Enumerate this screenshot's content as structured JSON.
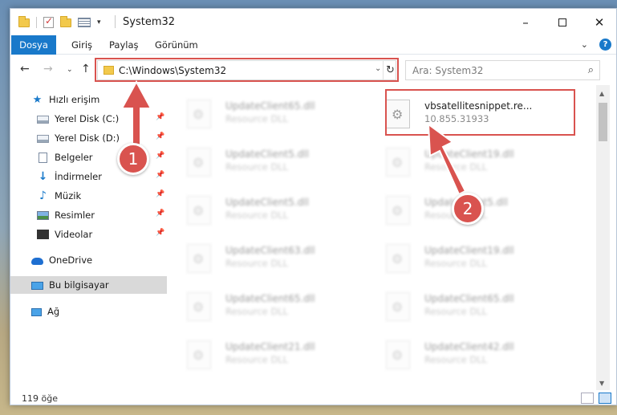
{
  "window": {
    "title": "System32",
    "controls": {
      "minimize": "–",
      "maximize": "",
      "close": "✕"
    }
  },
  "ribbon": {
    "tabs": [
      {
        "label": "Dosya",
        "active": true
      },
      {
        "label": "Giriş"
      },
      {
        "label": "Paylaş"
      },
      {
        "label": "Görünüm"
      }
    ],
    "collapse": "⌄",
    "help": "?"
  },
  "nav": {
    "back": "←",
    "forward": "→",
    "recent": "⌄",
    "up": "↑",
    "address": "C:\\Windows\\System32",
    "address_dropdown": "⌄",
    "refresh": "↻",
    "search_placeholder": "Ara: System32",
    "search_icon": "⌕"
  },
  "sidebar": {
    "items": [
      {
        "label": "Hızlı erişim",
        "icon": "star-icon"
      },
      {
        "label": "Yerel Disk (C:)",
        "icon": "drive-icon",
        "pinned": true
      },
      {
        "label": "Yerel Disk (D:)",
        "icon": "drive-icon",
        "pinned": true
      },
      {
        "label": "Belgeler",
        "icon": "documents-icon",
        "pinned": true
      },
      {
        "label": "İndirmeler",
        "icon": "downloads-icon",
        "pinned": true
      },
      {
        "label": "Müzik",
        "icon": "music-icon",
        "pinned": true
      },
      {
        "label": "Resimler",
        "icon": "pictures-icon",
        "pinned": true
      },
      {
        "label": "Videolar",
        "icon": "videos-icon",
        "pinned": true
      },
      {
        "label": "OneDrive",
        "icon": "onedrive-icon"
      },
      {
        "label": "Bu bilgisayar",
        "icon": "this-pc-icon",
        "selected": true
      },
      {
        "label": "Ağ",
        "icon": "network-icon"
      }
    ],
    "pin_glyph": "📌"
  },
  "files": {
    "left_column": [
      {
        "name": "UpdateClient65.dll",
        "desc": "Resource DLL"
      },
      {
        "name": "UpdateClient5.dll",
        "desc": "Resource DLL"
      },
      {
        "name": "UpdateClient5.dll",
        "desc": "Resource DLL"
      },
      {
        "name": "UpdateClient63.dll",
        "desc": "Resource DLL"
      },
      {
        "name": "UpdateClient65.dll",
        "desc": "Resource DLL"
      },
      {
        "name": "UpdateClient21.dll",
        "desc": "Resource DLL"
      }
    ],
    "right_column": [
      {
        "name": "vbsatellitesnippet.re...",
        "desc": "10.855.31933",
        "highlighted": true
      },
      {
        "name": "UpdateClient19.dll",
        "desc": "Resource DLL"
      },
      {
        "name": "UpdateClient5.dll",
        "desc": "Resource DLL"
      },
      {
        "name": "UpdateClient19.dll",
        "desc": "Resource DLL"
      },
      {
        "name": "UpdateClient65.dll",
        "desc": "Resource DLL"
      },
      {
        "name": "UpdateClient42.dll",
        "desc": "Resource DLL"
      }
    ]
  },
  "status": {
    "item_count": "119 öğe"
  },
  "annotations": {
    "marker_1": "1",
    "marker_2": "2",
    "color": "#d9534f"
  },
  "colors": {
    "accent": "#1979ca",
    "highlight": "#d9534f"
  }
}
